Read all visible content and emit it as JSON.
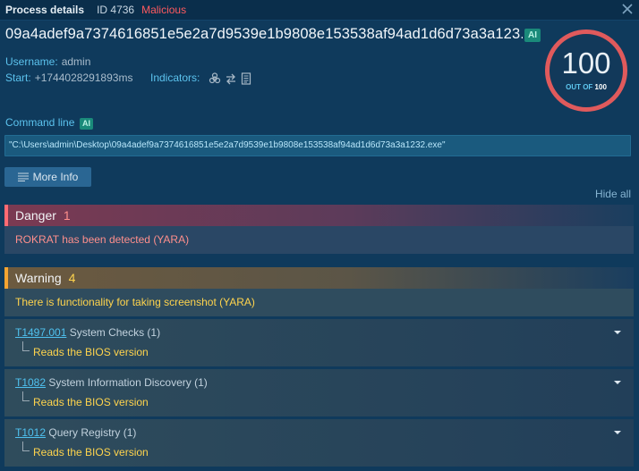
{
  "titlebar": {
    "title": "Process details",
    "id_label": "ID 4736",
    "status": "Malicious"
  },
  "process": {
    "hash": "09a4adef9a7374616851e5e2a7d9539e1b9808e153538af94ad1d6d73a3a123...",
    "ai_badge": "AI",
    "username_label": "Username:",
    "username": "admin",
    "start_label": "Start:",
    "start": "+1744028291893ms",
    "indicators_label": "Indicators:",
    "indicators": [
      "biohazard-icon",
      "network-arrows-icon",
      "document-icon"
    ]
  },
  "score": {
    "value": "100",
    "out_of_label": "OUT OF",
    "max": "100",
    "ring_color": "#e05a5c"
  },
  "command": {
    "label": "Command line",
    "ai_badge": "AI",
    "value": "\"C:\\Users\\admin\\Desktop\\09a4adef9a7374616851e5e2a7d9539e1b9808e153538af94ad1d6d73a3a1232.exe\""
  },
  "buttons": {
    "more_info": "More Info",
    "hide_all": "Hide all"
  },
  "danger": {
    "label": "Danger",
    "count": "1",
    "color": "#ff6b73",
    "items": [
      "ROKRAT has been detected (YARA)"
    ]
  },
  "warning": {
    "label": "Warning",
    "count": "4",
    "color": "#f6a531",
    "items": [
      "There is functionality for taking screenshot (YARA)"
    ],
    "techniques": [
      {
        "id": "T1497.001",
        "name": "System Checks (1)",
        "detail": "Reads the BIOS version"
      },
      {
        "id": "T1082",
        "name": "System Information Discovery (1)",
        "detail": "Reads the BIOS version"
      },
      {
        "id": "T1012",
        "name": "Query Registry (1)",
        "detail": "Reads the BIOS version"
      }
    ]
  }
}
